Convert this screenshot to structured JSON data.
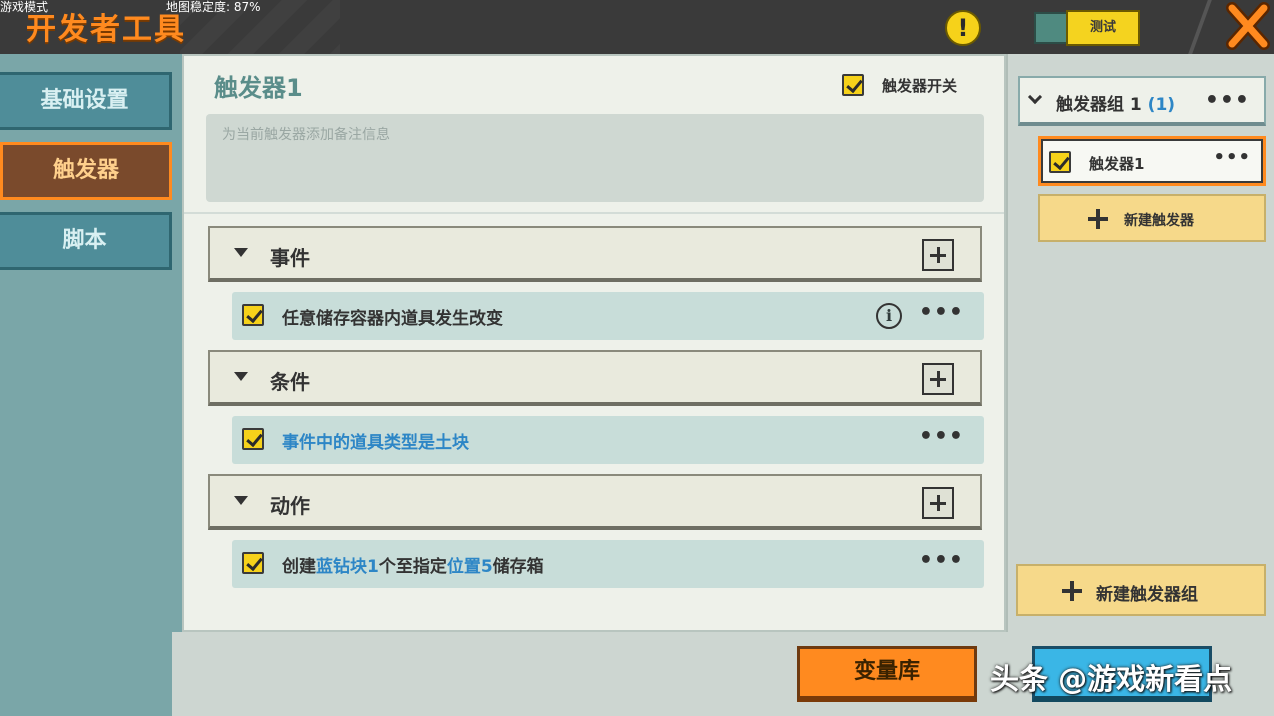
{
  "header": {
    "title": "开发者工具",
    "top_left_info": "游戏模式",
    "map_stability": "地图稳定度: 87%",
    "warning_symbol": "!",
    "test_button": "测试"
  },
  "tabs": [
    {
      "label": "基础设置",
      "active": false
    },
    {
      "label": "触发器",
      "active": true
    },
    {
      "label": "脚本",
      "active": false
    }
  ],
  "trigger": {
    "title": "触发器1",
    "switch_label": "触发器开关",
    "switch_checked": true,
    "note_placeholder": "为当前触发器添加备注信息"
  },
  "sections": {
    "event": {
      "label": "事件",
      "item": {
        "text": "任意储存容器内道具发生改变",
        "checked": true
      }
    },
    "condition": {
      "label": "条件",
      "item": {
        "text": "事件中的道具类型是土块",
        "checked": true
      }
    },
    "action": {
      "label": "动作",
      "item": {
        "p1": "创建",
        "h1": "蓝钻块",
        "h2": "1",
        "p2": "个至指定",
        "h3": "位置5",
        "p3": "储存箱",
        "checked": true
      }
    }
  },
  "right_panel": {
    "group_label": "触发器组 1",
    "group_count": "(1)",
    "item_label": "触发器1",
    "new_trigger": "新建触发器",
    "new_group": "新建触发器组"
  },
  "bottom": {
    "variable_library": "变量库"
  },
  "watermark": "头条 @游戏新看点",
  "colors": {
    "accent_orange": "#ff8a1f",
    "accent_yellow": "#f6d21a",
    "highlight_blue": "#2d86c6",
    "panel_teal": "#7aa6a8"
  },
  "icons": {
    "more": "•••",
    "info": "i"
  }
}
